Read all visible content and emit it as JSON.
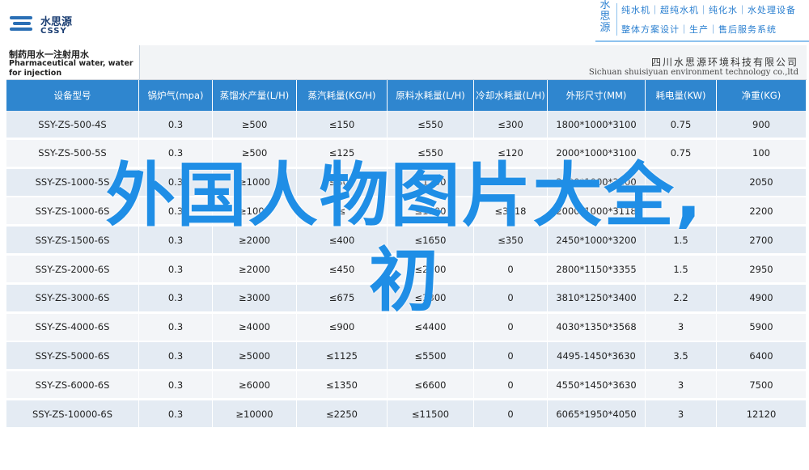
{
  "header": {
    "logo_cn": "水思源",
    "logo_en": "CSSY",
    "brand_vertical": "水思源",
    "brand_line1": "纯水机｜超纯水机｜纯化水｜水处理设备",
    "brand_line2": "整体方案设计｜生产｜售后服务系统"
  },
  "table": {
    "title_cn": "制药用水一注射用水",
    "title_en": "Pharmaceutical water, water for injection",
    "company_cn": "四川水思源环境科技有限公司",
    "company_en": "Sichuan shuisiyuan environment technology co.,ltd",
    "headers": [
      "设备型号",
      "锅炉气(mpa)",
      "蒸馏水产量(L/H)",
      "蒸汽耗量(KG/H)",
      "原料水耗量(L/H)",
      "冷却水耗量(L/H)",
      "外形尺寸(MM)",
      "耗电量(KW)",
      "净重(KG)"
    ],
    "rows": [
      [
        "SSY-ZS-500-4S",
        "0.3",
        "≥500",
        "≤150",
        "≤550",
        "≤300",
        "1800*1000*3100",
        "0.75",
        "900"
      ],
      [
        "SSY-ZS-500-5S",
        "0.3",
        "≥500",
        "≤125",
        "≤550",
        "≤120",
        "2000*1000*3100",
        "0.75",
        "100"
      ],
      [
        "SSY-ZS-1000-5S",
        "0.3",
        "≥1000",
        "≤300",
        "≤1100",
        "≤",
        "2000*1000*3100",
        "",
        "2050"
      ],
      [
        "SSY-ZS-1000-6S",
        "0.3",
        "≥1000",
        "≤",
        "≤1100",
        "≤3118",
        "2000*1000*3118",
        "",
        "2200"
      ],
      [
        "SSY-ZS-1500-6S",
        "0.3",
        "≥2000",
        "≤400",
        "≤1650",
        "≤350",
        "2450*1000*3200",
        "1.5",
        "2700"
      ],
      [
        "SSY-ZS-2000-6S",
        "0.3",
        "≥2000",
        "≤450",
        "≤2200",
        "0",
        "2800*1150*3355",
        "1.5",
        "2950"
      ],
      [
        "SSY-ZS-3000-6S",
        "0.3",
        "≥3000",
        "≤675",
        "≤3300",
        "0",
        "3810*1250*3400",
        "2.2",
        "4900"
      ],
      [
        "SSY-ZS-4000-6S",
        "0.3",
        "≥4000",
        "≤900",
        "≤4400",
        "0",
        "4030*1350*3568",
        "3",
        "5900"
      ],
      [
        "SSY-ZS-5000-6S",
        "0.3",
        "≥5000",
        "≤1125",
        "≤5500",
        "0",
        "4495-1450*3630",
        "3.5",
        "6400"
      ],
      [
        "SSY-ZS-6000-6S",
        "0.3",
        "≥6000",
        "≤1350",
        "≤6600",
        "0",
        "4550*1450*3630",
        "3",
        "7500"
      ],
      [
        "SSY-ZS-10000-6S",
        "0.3",
        "≥10000",
        "≤2250",
        "≤11500",
        "0",
        "6065*1950*4050",
        "3",
        "12120"
      ]
    ]
  },
  "overlay": {
    "line1": "外国人物图片大全,",
    "line2": "初"
  },
  "colors": {
    "header_blue": "#2f86cf",
    "overlay_blue": "#1f8ee6",
    "brand_blue": "#2a7fd0"
  }
}
